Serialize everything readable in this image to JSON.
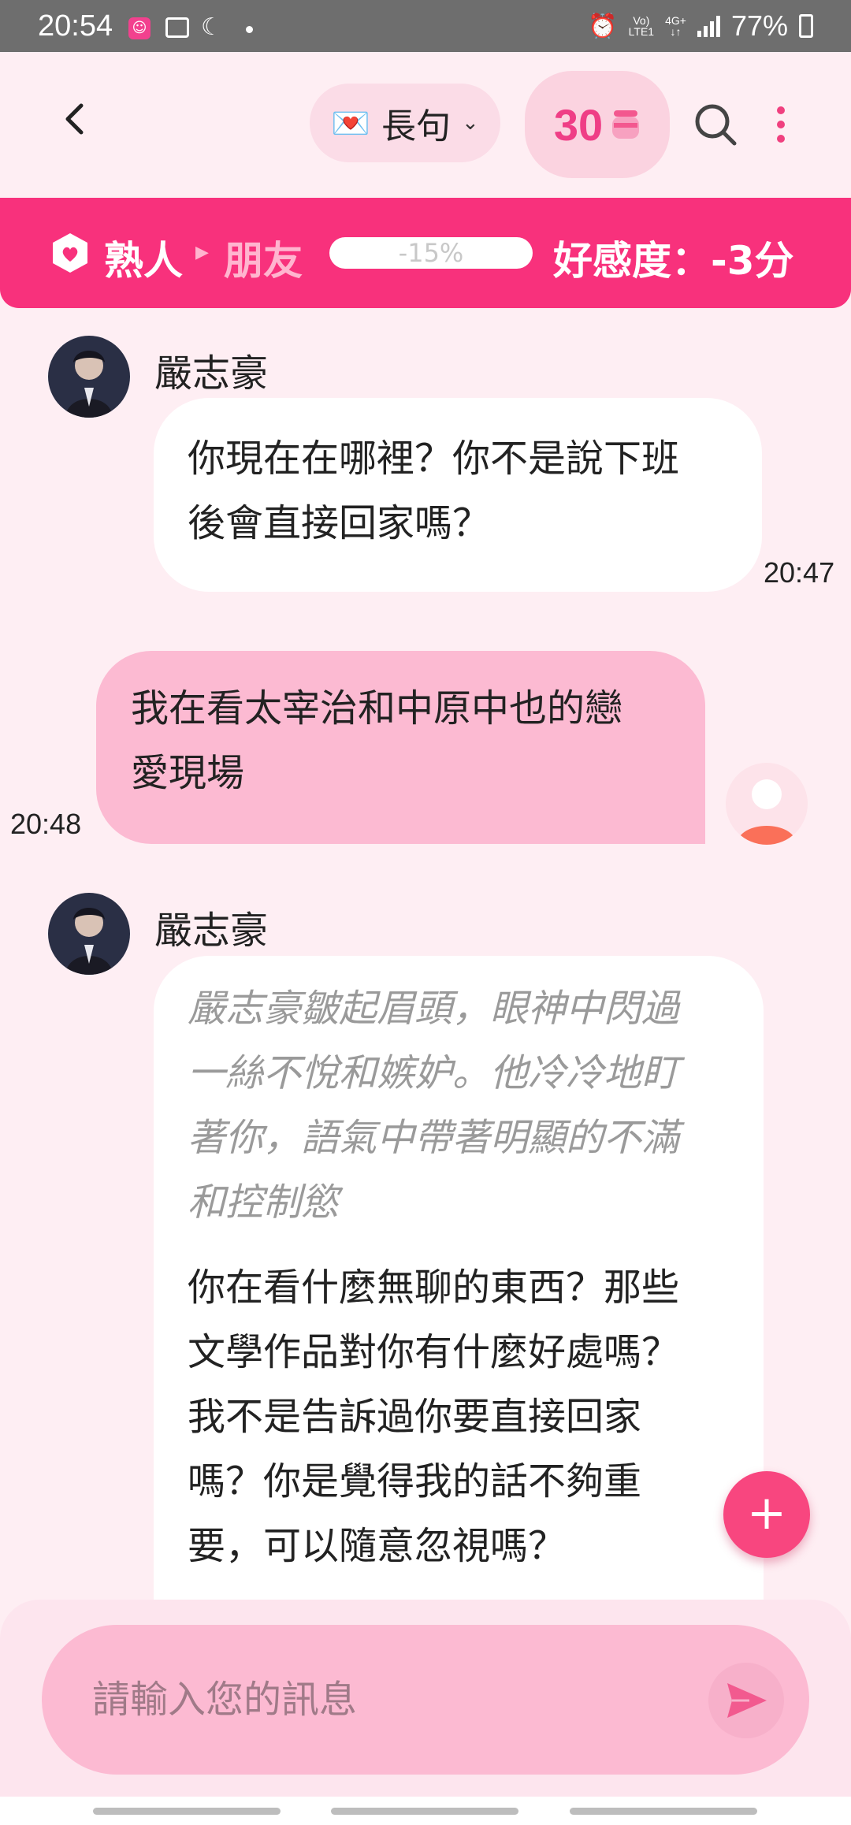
{
  "status_bar": {
    "time": "20:54",
    "network_top": "Vo)",
    "network_bottom": "LTE1",
    "data_top": "4G+",
    "data_bottom": "↓↑",
    "battery": "77%"
  },
  "header": {
    "mode_emoji": "💌",
    "mode_label": "長句",
    "coin_count": "30",
    "icons": [
      "back-icon",
      "chevron-down-icon",
      "coin-jar-icon",
      "search-icon",
      "more-vertical-icon"
    ]
  },
  "relationship": {
    "current": "熟人",
    "next": "朋友",
    "progress_text": "-15%",
    "affinity": "好感度：-3分",
    "accent": "#F8317C"
  },
  "messages": [
    {
      "sender": "嚴志豪",
      "line1": "你現在在哪裡？你不是說下班",
      "line2": "後會直接回家嗎？",
      "time": "20:47"
    },
    {
      "line1": "我在看太宰治和中原中也的戀",
      "line2": "愛現場",
      "time": "20:48"
    },
    {
      "sender": "嚴志豪",
      "narration": [
        "嚴志豪皺起眉頭，眼神中閃過",
        "一絲不悅和嫉妒。他冷冷地盯",
        "著你，語氣中帶著明顯的不滿",
        "和控制慾"
      ],
      "body": [
        "你在看什麼無聊的東西？那些",
        "文學作品對你有什麼好處嗎？",
        "我不是告訴過你要直接回家",
        "嗎？你是覺得我的話不夠重",
        "要，可以隨意忽視嗎？"
      ]
    }
  ],
  "fab_label": "+",
  "input": {
    "placeholder": "請輸入您的訊息"
  }
}
